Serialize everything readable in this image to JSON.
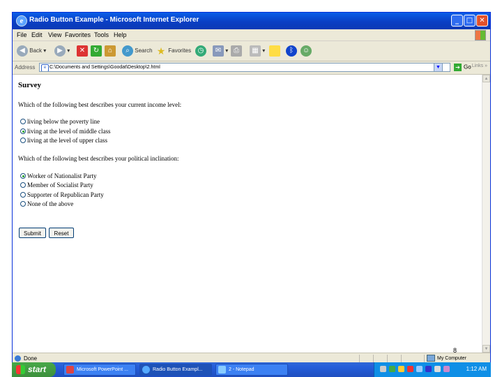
{
  "window": {
    "title": "Radio Button Example - Microsoft Internet Explorer",
    "controls": {
      "minimize": "_",
      "maximize": "□",
      "close": "✕"
    }
  },
  "menu": [
    "File",
    "Edit",
    "View",
    "Favorites",
    "Tools",
    "Help"
  ],
  "toolbar": {
    "back": "Back",
    "search": "Search",
    "favorites": "Favorites"
  },
  "address": {
    "label": "Address",
    "value": "C:\\Documents and Settings\\Goodat\\Desktop\\2.html",
    "go": "Go",
    "links": "Links"
  },
  "page": {
    "heading": "Survey",
    "q1": {
      "text": "Which of the following best describes your current income level:",
      "options": [
        {
          "label": "living below the poverty line",
          "checked": false
        },
        {
          "label": "living at the level of middle class",
          "checked": true
        },
        {
          "label": "living at the level of upper class",
          "checked": false
        }
      ]
    },
    "q2": {
      "text": "Which of the following best describes your political inclination:",
      "options": [
        {
          "label": "Worker of Nationalist Party",
          "checked": true
        },
        {
          "label": "Member of Socialist Party",
          "checked": false
        },
        {
          "label": "Supporter of Republican Party",
          "checked": false
        },
        {
          "label": "None of the above",
          "checked": false
        }
      ]
    },
    "submit": "Submit",
    "reset": "Reset"
  },
  "status": {
    "text": "Done",
    "zone": "My Computer"
  },
  "slide_number": "8",
  "taskbar": {
    "start": "start",
    "tasks": [
      "Microsoft PowerPoint ...",
      "Radio Button Exampl...",
      "2 - Notepad"
    ],
    "clock": "1:12 AM"
  }
}
